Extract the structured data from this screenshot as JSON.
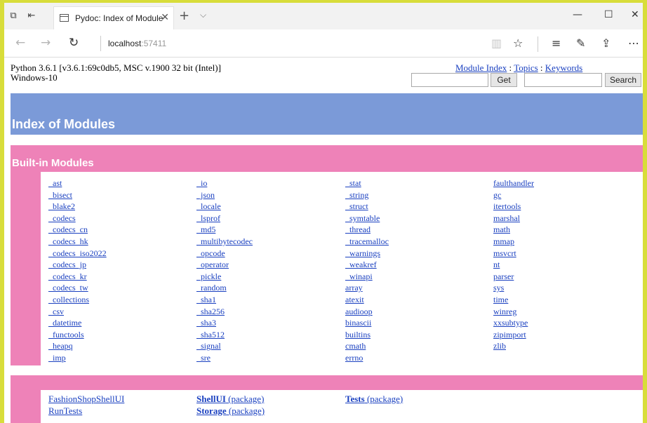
{
  "browser": {
    "tab_title": "Pydoc: Index of Module",
    "url_host": "localhost",
    "url_port": ":57411"
  },
  "header": {
    "version_line1": "Python 3.6.1 [v3.6.1:69c0db5, MSC v.1900 32 bit (Intel)]",
    "version_line2": "Windows-10",
    "link_module_index": "Module Index",
    "link_topics": "Topics",
    "link_keywords": "Keywords",
    "sep": " : ",
    "get_button": "Get",
    "search_button": "Search",
    "get_value": "",
    "search_value": ""
  },
  "index_title": "Index of Modules",
  "builtin": {
    "title": "Built-in Modules",
    "columns": [
      [
        "_ast",
        "_bisect",
        "_blake2",
        "_codecs",
        "_codecs_cn",
        "_codecs_hk",
        "_codecs_iso2022",
        "_codecs_jp",
        "_codecs_kr",
        "_codecs_tw",
        "_collections",
        "_csv",
        "_datetime",
        "_functools",
        "_heapq",
        "_imp"
      ],
      [
        "_io",
        "_json",
        "_locale",
        "_lsprof",
        "_md5",
        "_multibytecodec",
        "_opcode",
        "_operator",
        "_pickle",
        "_random",
        "_sha1",
        "_sha256",
        "_sha3",
        "_sha512",
        "_signal",
        "_sre"
      ],
      [
        "_stat",
        "_string",
        "_struct",
        "_symtable",
        "_thread",
        "_tracemalloc",
        "_warnings",
        "_weakref",
        "_winapi",
        "array",
        "atexit",
        "audioop",
        "binascii",
        "builtins",
        "cmath",
        "errno"
      ],
      [
        "faulthandler",
        "gc",
        "itertools",
        "marshal",
        "math",
        "mmap",
        "msvcrt",
        "nt",
        "parser",
        "sys",
        "time",
        "winreg",
        "xxsubtype",
        "zipimport",
        "zlib"
      ]
    ]
  },
  "packages": {
    "fashion": "FashionShopShellUI",
    "runtests": "RunTests",
    "shellui": "ShellUI",
    "storage": "Storage",
    "tests": "Tests",
    "package_suffix": " (package)"
  }
}
